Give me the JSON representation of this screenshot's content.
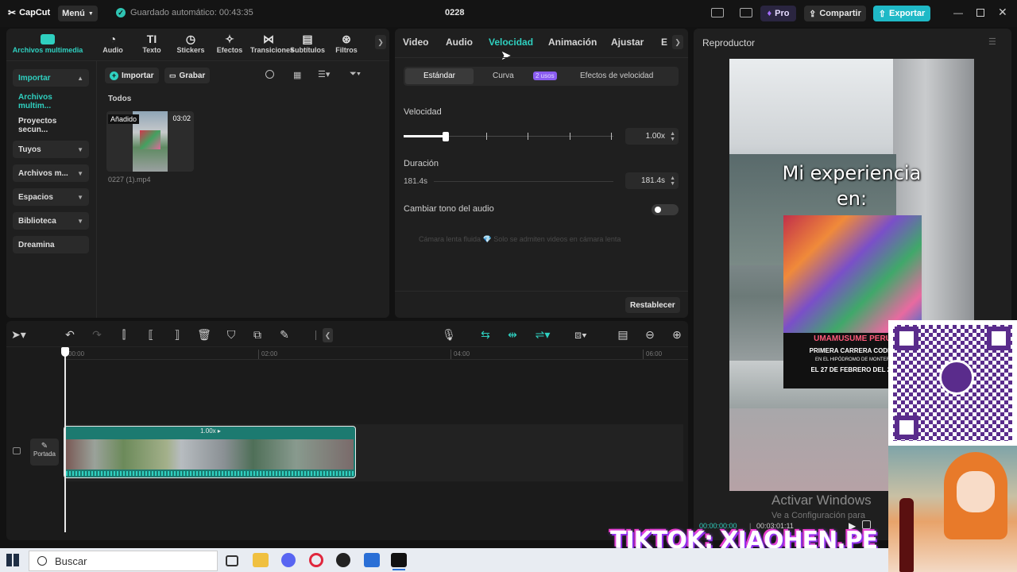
{
  "app": {
    "logo": "CapCut",
    "menu": "Menú",
    "autosave": "Guardado automático: 00:43:35",
    "project_title": "0228",
    "pro": "Pro",
    "share": "Compartir",
    "export": "Exportar"
  },
  "media_tabs": [
    {
      "label": "Archivos multimedia",
      "icon": "media-icon"
    },
    {
      "label": "Audio",
      "icon": "audio-icon"
    },
    {
      "label": "Texto",
      "icon": "text-icon"
    },
    {
      "label": "Stickers",
      "icon": "sticker-icon"
    },
    {
      "label": "Efectos",
      "icon": "effects-icon"
    },
    {
      "label": "Transiciones",
      "icon": "transition-icon"
    },
    {
      "label": "Subtítulos",
      "icon": "subtitle-icon"
    },
    {
      "label": "Filtros",
      "icon": "filter-icon"
    }
  ],
  "sidebar": [
    {
      "label": "Importar"
    },
    {
      "label": "Archivos multim..."
    },
    {
      "label": "Proyectos secun..."
    },
    {
      "label": "Tuyos"
    },
    {
      "label": "Archivos m..."
    },
    {
      "label": "Espacios"
    },
    {
      "label": "Biblioteca"
    },
    {
      "label": "Dreamina"
    }
  ],
  "media": {
    "import_btn": "Importar",
    "record_btn": "Grabar",
    "section": "Todos",
    "clip": {
      "badge": "Añadido",
      "duration": "03:02",
      "filename": "0227 (1).mp4"
    }
  },
  "props": {
    "tabs": [
      "Video",
      "Audio",
      "Velocidad",
      "Animación",
      "Ajustar",
      "E"
    ],
    "active_tab": "Velocidad",
    "subtabs": {
      "standard": "Estándar",
      "curve": "Curva",
      "uses": "2 usos",
      "effects": "Efectos de velocidad"
    },
    "speed_label": "Velocidad",
    "speed_value": "1.00x",
    "speed_level": 0.2,
    "duration_label": "Duración",
    "duration_start": "181.4s",
    "duration_value": "181.4s",
    "pitch_label": "Cambiar tono del audio",
    "slowmo": "Cámara lenta fluida 💎 Solo se admiten videos en cámara lenta",
    "reset": "Restablecer"
  },
  "player": {
    "title": "Reproductor",
    "caption1": "Mi experiencia",
    "caption2": "en:",
    "poster_title": "UMAMUSUME PERÚ",
    "poster_l1": "PRIMERA CARRERA CODPL",
    "poster_l2": "EN EL HIPÓDROMO DE MONTER",
    "poster_l3": "EL 27 DE FEBRERO DEL 20",
    "time_current": "00:00:00:00",
    "time_total": "00:03:01:11",
    "watermark1": "Activar Windows",
    "watermark2": "Ve a Configuración para"
  },
  "timeline": {
    "ruler": [
      "00:00",
      "02:00",
      "04:00",
      "06:00"
    ],
    "clip_speed": "1.00x ▸",
    "cover": "Portada"
  },
  "overlay": {
    "tiktok": "TIKTOK: XIAOHEN.PE"
  },
  "taskbar": {
    "search": "Buscar"
  },
  "colors": {
    "accent": "#2fd0c0",
    "clip": "#1c7a70",
    "export": "#1fb9c7",
    "pro": "#a46cff"
  }
}
